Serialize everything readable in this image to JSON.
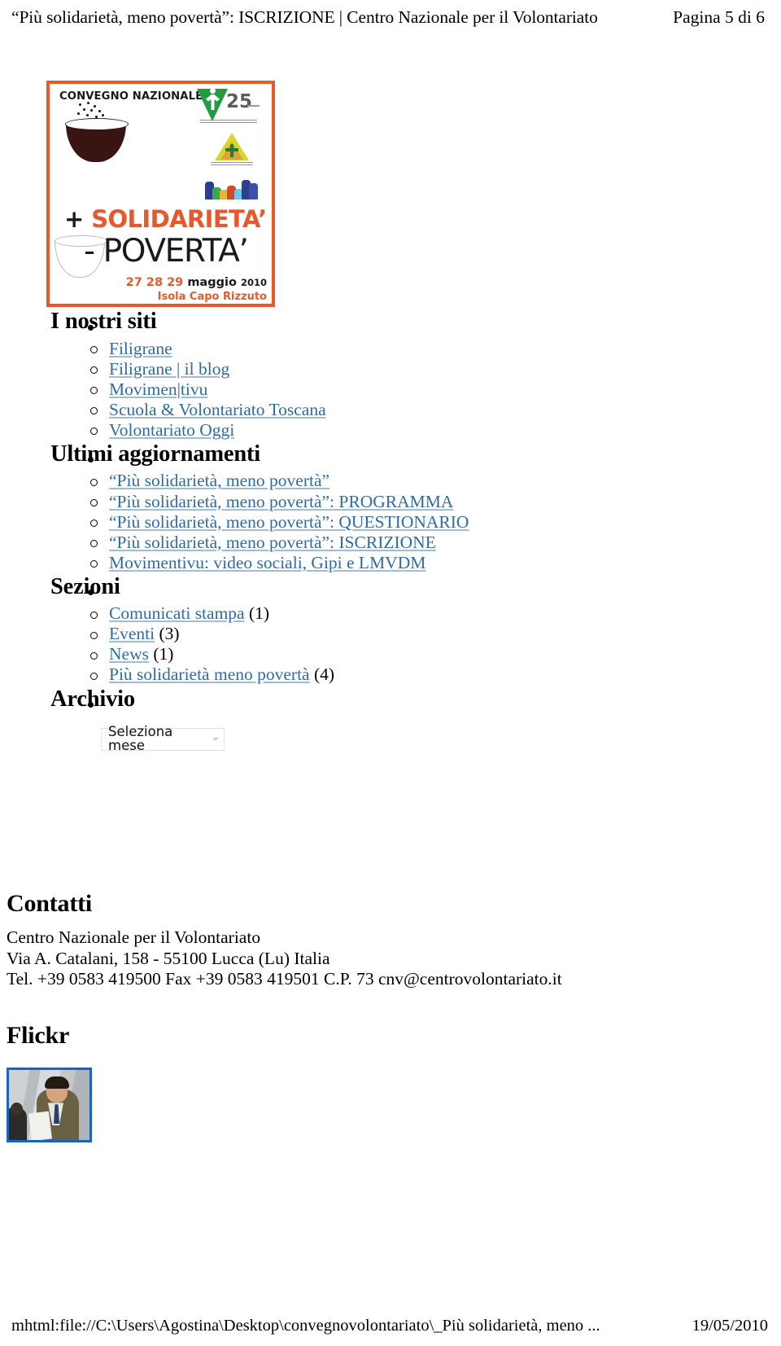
{
  "header": {
    "title": "“Più solidarietà, meno povertà”: ISCRIZIONE | Centro Nazionale per il Volontariato",
    "page_indicator": "Pagina 5 di 6"
  },
  "poster": {
    "alt_name": "convegno-nazionale-poster",
    "kicker": "CONVEGNO NAZIONALE",
    "line_plus": "+",
    "line_solidarieta": "SOLIDARIETA’",
    "line_poverta": "- POVERTA’",
    "date_days": "27 28 29",
    "date_month": "maggio",
    "date_year": "2010",
    "place": "Isola Capo Rizzuto",
    "border_color": "#e8582a",
    "accent_color": "#e8582a",
    "logos": [
      "v25-logo",
      "triangle-cross-logo",
      "hands-logo"
    ]
  },
  "widgets": [
    {
      "title": "I nostri siti",
      "items": [
        {
          "label": "Filigrane",
          "count": ""
        },
        {
          "label": "Filigrane | il blog",
          "count": ""
        },
        {
          "label": "Movimen|tivu",
          "count": ""
        },
        {
          "label": "Scuola & Volontariato Toscana",
          "count": ""
        },
        {
          "label": "Volontariato Oggi",
          "count": ""
        }
      ]
    },
    {
      "title": "Ultimi aggiornamenti",
      "items": [
        {
          "label": "“Più solidarietà, meno povertà”",
          "count": ""
        },
        {
          "label": "“Più solidarietà, meno povertà”: PROGRAMMA",
          "count": ""
        },
        {
          "label": "“Più solidarietà, meno povertà”: QUESTIONARIO",
          "count": ""
        },
        {
          "label": "“Più solidarietà, meno povertà”: ISCRIZIONE",
          "count": ""
        },
        {
          "label": "Movimentivu: video sociali, Gipi e LMVDM",
          "count": ""
        }
      ]
    },
    {
      "title": "Sezioni",
      "items": [
        {
          "label": "Comunicati stampa",
          "count": " (1)"
        },
        {
          "label": "Eventi",
          "count": " (3)"
        },
        {
          "label": "News",
          "count": " (1)"
        },
        {
          "label": "Più solidarietà meno povertà",
          "count": " (4)"
        }
      ]
    },
    {
      "title": "Archivio",
      "items": []
    }
  ],
  "archive": {
    "select_value": "Seleziona mese",
    "caret_icon": "chevron-down-icon"
  },
  "contatti": {
    "heading": "Contatti",
    "lines": [
      "Centro Nazionale per il Volontariato",
      "Via A. Catalani, 158 - 55100 Lucca (Lu) Italia",
      "Tel. +39 0583 419500 Fax +39 0583 419501 C.P. 73 cnv@centrovolontariato.it"
    ]
  },
  "flickr": {
    "heading": "Flickr",
    "thumbnail_alt": "flickr-photo-thumbnail",
    "thumbnail_border_color": "#1a62c4"
  },
  "footer": {
    "path": "mhtml:file://C:\\Users\\Agostina\\Desktop\\convegnovolontariato\\_Più solidarietà, meno ...",
    "date": "19/05/2010"
  },
  "colors": {
    "link": "#2e6ca4",
    "text": "#000000",
    "poster_orange": "#e8582a",
    "flickr_blue": "#1a62c4"
  }
}
